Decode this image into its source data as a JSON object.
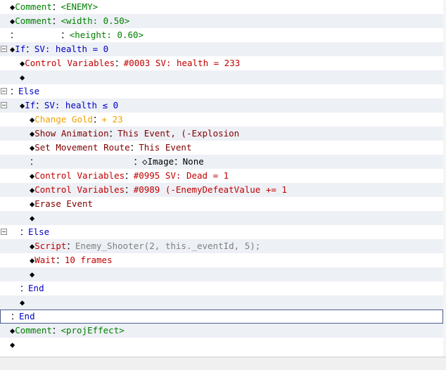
{
  "event_commands": [
    {
      "indent": 0,
      "fold": false,
      "marker": "◆",
      "command": "Comment",
      "command_color": "#008000",
      "sep": "：",
      "params": "<ENEMY>",
      "params_color": "#008000"
    },
    {
      "indent": 0,
      "fold": false,
      "marker": "◆",
      "command": "Comment",
      "command_color": "#008000",
      "sep": "：",
      "params": "<width: 0.50>",
      "params_color": "#008000"
    },
    {
      "indent": 0,
      "fold": false,
      "marker": "：",
      "command": "",
      "command_color": "#000000",
      "sep": "        ：",
      "params": "<height: 0.60>",
      "params_color": "#008000"
    },
    {
      "indent": 0,
      "fold": true,
      "marker": "◆",
      "command": "If",
      "command_color": "#0000c8",
      "sep": "：",
      "params": "SV: health = 0",
      "params_color": "#0000c8"
    },
    {
      "indent": 1,
      "fold": false,
      "marker": "◆",
      "command": "Control Variables",
      "command_color": "#c00000",
      "sep": "：",
      "params": "#0003 SV: health = 233",
      "params_color": "#c00000"
    },
    {
      "indent": 1,
      "fold": false,
      "marker": "◆",
      "command": "",
      "command_color": "#000000",
      "sep": "",
      "params": "",
      "params_color": "#000000"
    },
    {
      "indent": 0,
      "fold": true,
      "marker": "：",
      "command": "Else",
      "command_color": "#0000c8",
      "sep": "",
      "params": "",
      "params_color": "#0000c8"
    },
    {
      "indent": 1,
      "fold": true,
      "marker": "◆",
      "command": "If",
      "command_color": "#0000c8",
      "sep": "：",
      "params": "SV: health ≤ 0",
      "params_color": "#0000c8"
    },
    {
      "indent": 2,
      "fold": false,
      "marker": "◆",
      "command": "Change Gold",
      "command_color": "#f0a000",
      "sep": "：",
      "params": "+ 23",
      "params_color": "#f0a000"
    },
    {
      "indent": 2,
      "fold": false,
      "marker": "◆",
      "command": "Show Animation",
      "command_color": "#800000",
      "sep": "：",
      "params": "This Event, (-Explosion",
      "params_color": "#800000"
    },
    {
      "indent": 2,
      "fold": false,
      "marker": "◆",
      "command": "Set Movement Route",
      "command_color": "#800000",
      "sep": "：",
      "params": "This Event",
      "params_color": "#800000"
    },
    {
      "indent": 2,
      "fold": false,
      "marker": "：",
      "command": "",
      "command_color": "#000000",
      "sep": "                  ：",
      "params": "◇Image：None",
      "params_color": "#000000"
    },
    {
      "indent": 2,
      "fold": false,
      "marker": "◆",
      "command": "Control Variables",
      "command_color": "#c00000",
      "sep": "：",
      "params": "#0995 SV: Dead = 1",
      "params_color": "#c00000"
    },
    {
      "indent": 2,
      "fold": false,
      "marker": "◆",
      "command": "Control Variables",
      "command_color": "#c00000",
      "sep": "：",
      "params": "#0989 (-EnemyDefeatValue += 1",
      "params_color": "#c00000"
    },
    {
      "indent": 2,
      "fold": false,
      "marker": "◆",
      "command": "Erase Event",
      "command_color": "#800000",
      "sep": "",
      "params": "",
      "params_color": "#800000"
    },
    {
      "indent": 2,
      "fold": false,
      "marker": "◆",
      "command": "",
      "command_color": "#000000",
      "sep": "",
      "params": "",
      "params_color": "#000000"
    },
    {
      "indent": 1,
      "fold": true,
      "marker": "：",
      "command": "Else",
      "command_color": "#0000c8",
      "sep": "",
      "params": "",
      "params_color": "#0000c8"
    },
    {
      "indent": 2,
      "fold": false,
      "marker": "◆",
      "command": "Script",
      "command_color": "#c00000",
      "sep": "：",
      "params": "Enemy_Shooter(2, this._eventId, 5);",
      "params_color": "#808080"
    },
    {
      "indent": 2,
      "fold": false,
      "marker": "◆",
      "command": "Wait",
      "command_color": "#c00000",
      "sep": "：",
      "params": "10 frames",
      "params_color": "#c00000"
    },
    {
      "indent": 2,
      "fold": false,
      "marker": "◆",
      "command": "",
      "command_color": "#000000",
      "sep": "",
      "params": "",
      "params_color": "#000000"
    },
    {
      "indent": 1,
      "fold": false,
      "marker": "：",
      "command": "End",
      "command_color": "#0000c8",
      "sep": "",
      "params": "",
      "params_color": "#0000c8"
    },
    {
      "indent": 1,
      "fold": false,
      "marker": "◆",
      "command": "",
      "command_color": "#000000",
      "sep": "",
      "params": "",
      "params_color": "#000000"
    },
    {
      "indent": 0,
      "fold": false,
      "marker": "：",
      "command": "End",
      "command_color": "#0000c8",
      "sep": "",
      "params": "",
      "params_color": "#0000c8",
      "selected": true
    },
    {
      "indent": 0,
      "fold": false,
      "marker": "◆",
      "command": "Comment",
      "command_color": "#008000",
      "sep": "：",
      "params": "<projEffect>",
      "params_color": "#008000"
    },
    {
      "indent": 0,
      "fold": false,
      "marker": "◆",
      "command": "",
      "command_color": "#000000",
      "sep": "",
      "params": "",
      "params_color": "#000000"
    }
  ]
}
